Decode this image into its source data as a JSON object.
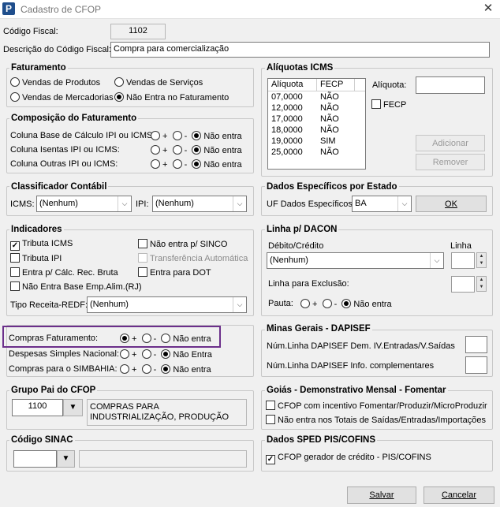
{
  "window": {
    "title": "Cadastro de CFOP",
    "logo_letter": "P",
    "close_glyph": "✕"
  },
  "codigo_fiscal": {
    "label": "Código Fiscal:",
    "value": "1102"
  },
  "descricao": {
    "label": "Descrição do Código Fiscal:",
    "value": "Compra para comercialização"
  },
  "faturamento": {
    "title": "Faturamento",
    "options": [
      "Vendas de Produtos",
      "Vendas de Serviços",
      "Vendas de Mercadorias",
      "Não Entra no Faturamento"
    ],
    "selected": "Não Entra no Faturamento"
  },
  "aliquotas": {
    "title": "Alíquotas ICMS",
    "headers": [
      "Alíquota",
      "FECP"
    ],
    "rows": [
      [
        "07,0000",
        "NÃO"
      ],
      [
        "12,0000",
        "NÃO"
      ],
      [
        "17,0000",
        "NÃO"
      ],
      [
        "18,0000",
        "NÃO"
      ],
      [
        "19,0000",
        "SIM"
      ],
      [
        "25,0000",
        "NÃO"
      ]
    ],
    "aliquota_label": "Alíquota:",
    "fecp_label": "FECP",
    "adicionar": "Adicionar",
    "remover": "Remover"
  },
  "composicao": {
    "title": "Composição do Faturamento",
    "rows": [
      {
        "label": "Coluna Base de Cálculo IPI ou ICMS:",
        "selected": "Não entra"
      },
      {
        "label": "Coluna Isentas IPI ou ICMS:",
        "selected": "Não entra"
      },
      {
        "label": "Coluna Outras IPI ou ICMS:",
        "selected": "Não entra"
      }
    ],
    "opt_plus": "+",
    "opt_minus": "-",
    "opt_none": "Não entra"
  },
  "classificador": {
    "title": "Classificador Contábil",
    "icms_label": "ICMS:",
    "icms_value": "(Nenhum)",
    "ipi_label": "IPI:",
    "ipi_value": "(Nenhum)"
  },
  "dados_estado": {
    "title": "Dados Específicos por Estado",
    "uf_label": "UF Dados Específicos:",
    "uf_value": "BA",
    "ok": "OK"
  },
  "indicadores": {
    "title": "Indicadores",
    "tributa_icms": "Tributa ICMS",
    "tributa_ipi": "Tributa IPI",
    "entra_calc": "Entra p/ Cálc. Rec. Bruta",
    "nao_entra_base": "Não Entra Base Emp.Alim.(RJ)",
    "nao_entra_sinco": "Não entra p/ SINCO",
    "transferencia": "Transferência Automática",
    "entra_dot": "Entra para DOT",
    "tipo_receita_label": "Tipo Receita-REDF:",
    "tipo_receita_value": "(Nenhum)"
  },
  "linha_dacon": {
    "title": "Linha p/ DACON",
    "debito_label": "Débito/Crédito",
    "debito_value": "(Nenhum)",
    "linha_label": "Linha",
    "exclusao_label": "Linha para Exclusão:",
    "pauta_label": "Pauta:",
    "pauta_selected": "Não entra"
  },
  "compras": {
    "rows": [
      {
        "label": "Compras Faturamento:",
        "selected": "+"
      },
      {
        "label": "Despesas Simples Nacional:",
        "selected": "Não Entra"
      },
      {
        "label": "Compras para o SIMBAHIA:",
        "selected": "Não entra"
      }
    ],
    "none_1": "Não entra",
    "none_2": "Não Entra",
    "none_3": "Não entra"
  },
  "minas": {
    "title": "Minas Gerais - DAPISEF",
    "dem_label": "Núm.Linha DAPISEF Dem. IV.Entradas/V.Saídas",
    "info_label": "Núm.Linha DAPISEF Info. complementares"
  },
  "grupo_pai": {
    "title": "Grupo Pai do CFOP",
    "code": "1100",
    "description": "COMPRAS PARA INDUSTRIALIZAÇÃO, PRODUÇÃO"
  },
  "goias": {
    "title": "Goiás - Demonstrativo Mensal - Fomentar",
    "opt1": "CFOP com incentivo  Fomentar/Produzir/MicroProduzir",
    "opt2": "Não entra nos Totais de  Saídas/Entradas/Importações"
  },
  "sinac": {
    "title": "Código SINAC"
  },
  "sped": {
    "title": "Dados SPED PIS/COFINS",
    "gerador": "CFOP gerador de crédito - PIS/COFINS"
  },
  "footer": {
    "salvar": "Salvar",
    "cancelar": "Cancelar"
  }
}
